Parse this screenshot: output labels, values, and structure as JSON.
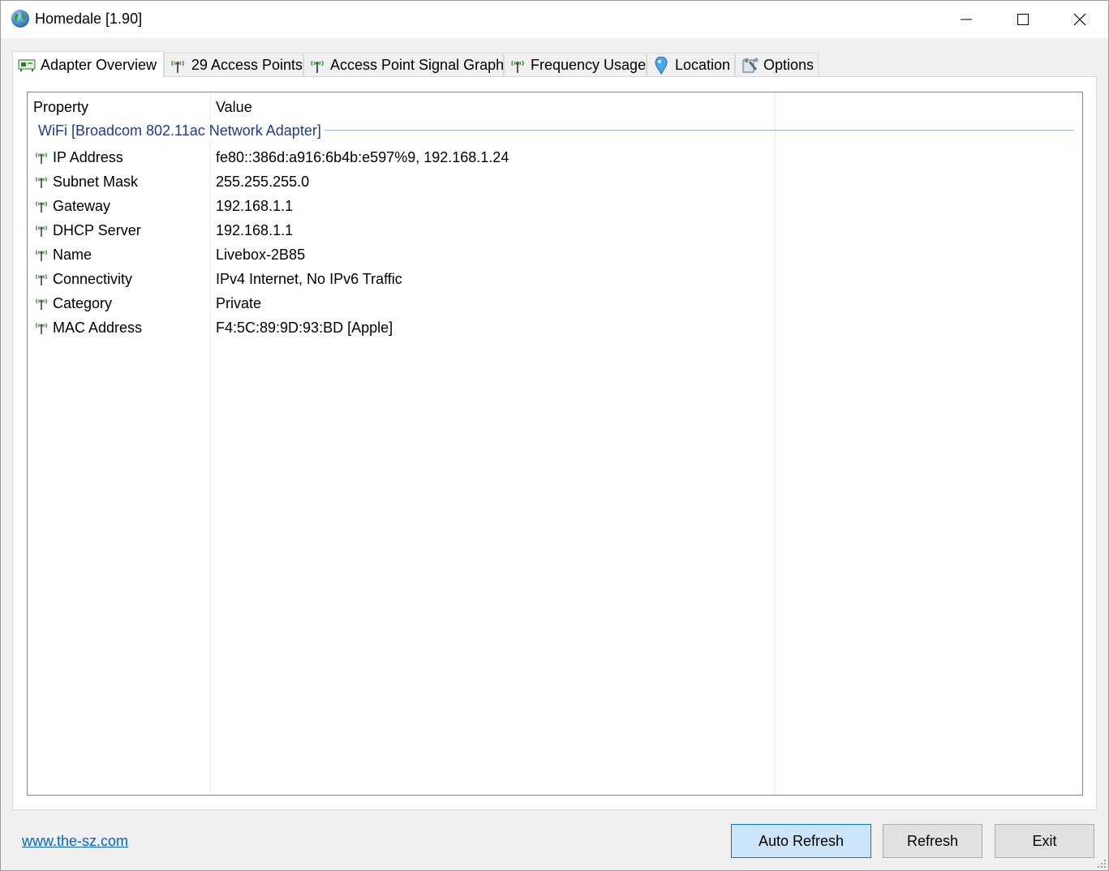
{
  "window": {
    "title": "Homedale [1.90]"
  },
  "tabs": [
    {
      "label": "Adapter Overview",
      "icon": "network-card-icon",
      "active": true
    },
    {
      "label": "29 Access Points",
      "icon": "antenna-icon",
      "active": false
    },
    {
      "label": "Access Point Signal Graph",
      "icon": "antenna-icon",
      "active": false
    },
    {
      "label": "Frequency Usage",
      "icon": "antenna-icon",
      "active": false
    },
    {
      "label": "Location",
      "icon": "map-pin-icon",
      "active": false
    },
    {
      "label": "Options",
      "icon": "tools-icon",
      "active": false
    }
  ],
  "list": {
    "columns": [
      "Property",
      "Value"
    ],
    "group": "WiFi [Broadcom 802.11ac Network Adapter]",
    "rows": [
      {
        "property": "IP Address",
        "value": "fe80::386d:a916:6b4b:e597%9, 192.168.1.24"
      },
      {
        "property": "Subnet Mask",
        "value": "255.255.255.0"
      },
      {
        "property": "Gateway",
        "value": "192.168.1.1"
      },
      {
        "property": "DHCP Server",
        "value": "192.168.1.1"
      },
      {
        "property": "Name",
        "value": "Livebox-2B85"
      },
      {
        "property": "Connectivity",
        "value": "IPv4 Internet, No IPv6 Traffic"
      },
      {
        "property": "Category",
        "value": "Private"
      },
      {
        "property": "MAC Address",
        "value": "F4:5C:89:9D:93:BD [Apple]"
      }
    ]
  },
  "footer": {
    "link": "www.the-sz.com",
    "auto_refresh": "Auto Refresh",
    "refresh": "Refresh",
    "exit": "Exit"
  },
  "colors": {
    "group_header": "#1e3c91",
    "link": "#0066cc",
    "default_button": "#cce4f7"
  }
}
